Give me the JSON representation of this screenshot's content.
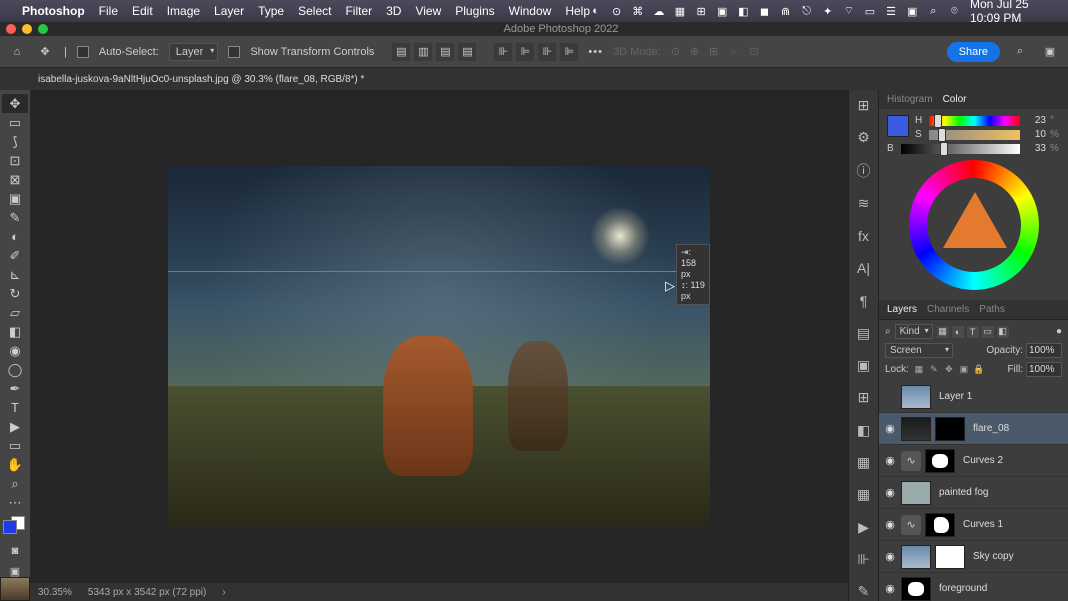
{
  "menubar": {
    "app": "Photoshop",
    "items": [
      "File",
      "Edit",
      "Image",
      "Layer",
      "Type",
      "Select",
      "Filter",
      "3D",
      "View",
      "Plugins",
      "Window",
      "Help"
    ],
    "datetime": "Mon Jul 25  10:09 PM"
  },
  "window": {
    "title": "Adobe Photoshop 2022"
  },
  "options": {
    "auto_select": "Auto-Select:",
    "layer_dropdown": "Layer",
    "show_transform": "Show Transform Controls",
    "mode_3d": "3D Mode:",
    "share": "Share"
  },
  "doc_tab": "isabella-juskova-9aNltHjuOc0-unsplash.jpg @ 30.3% (flare_08, RGB/8*) *",
  "drag_tooltip": {
    "l1": "⇥: 158 px",
    "l2": "↕: 119 px"
  },
  "status": {
    "zoom": "30.35%",
    "dims": "5343 px x 3542 px (72 ppi)"
  },
  "color": {
    "tabs": {
      "histogram": "Histogram",
      "color": "Color"
    },
    "h": {
      "label": "H",
      "val": "23",
      "unit": "°"
    },
    "s": {
      "label": "S",
      "val": "10",
      "unit": "%"
    },
    "b": {
      "label": "B",
      "val": "33",
      "unit": "%"
    }
  },
  "layers_panel": {
    "tabs": {
      "layers": "Layers",
      "channels": "Channels",
      "paths": "Paths"
    },
    "kind_label": "Kind",
    "blend": "Screen",
    "opacity_label": "Opacity:",
    "opacity_val": "100%",
    "lock_label": "Lock:",
    "fill_label": "Fill:",
    "fill_val": "100%",
    "layers": [
      {
        "name": "Layer 1"
      },
      {
        "name": "flare_08"
      },
      {
        "name": "Curves 2"
      },
      {
        "name": "painted fog"
      },
      {
        "name": "Curves 1"
      },
      {
        "name": "Sky copy"
      },
      {
        "name": "foreground"
      }
    ]
  },
  "tooltips": {
    "move": "Move",
    "marquee": "Rectangular Marquee",
    "lasso": "Lasso",
    "wand": "Object Selection",
    "crop": "Crop",
    "frame": "Frame",
    "eyedrop": "Eyedropper",
    "heal": "Spot Healing",
    "brush": "Brush",
    "stamp": "Clone Stamp",
    "history": "History Brush",
    "eraser": "Eraser",
    "gradient": "Gradient",
    "blur": "Blur",
    "dodge": "Dodge",
    "pen": "Pen",
    "type": "Type",
    "path": "Path Selection",
    "shape": "Rectangle",
    "hand": "Hand",
    "zoom": "Zoom"
  }
}
